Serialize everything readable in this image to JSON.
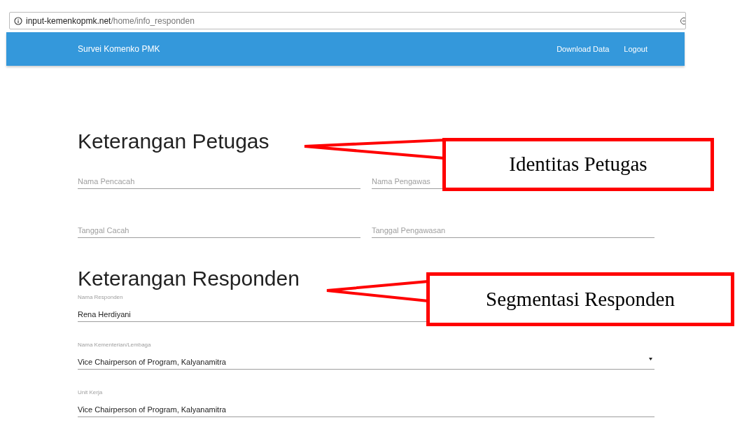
{
  "address_bar": {
    "host": "input-kemenkopmk.net",
    "path": "/home/info_responden"
  },
  "navbar": {
    "brand": "Survei Komenko PMK",
    "links": [
      "Download Data",
      "Logout"
    ]
  },
  "sections": [
    {
      "title": "Keterangan Petugas",
      "kind": "grid",
      "fields": [
        {
          "kind": "text",
          "placeholder": "Nama Pencacah"
        },
        {
          "kind": "text",
          "placeholder": "Nama Pengawas"
        },
        {
          "kind": "text",
          "placeholder": "Tanggal Cacah"
        },
        {
          "kind": "text",
          "placeholder": "Tanggal Pengawasan"
        }
      ]
    },
    {
      "title": "Keterangan Responden",
      "kind": "stack",
      "fields": [
        {
          "kind": "text",
          "label": "Nama Responden",
          "value": "Rena Herdiyani"
        },
        {
          "kind": "select",
          "label": "Nama Kementerian/Lembaga",
          "value": "Vice Chairperson of Program, Kalyanamitra"
        },
        {
          "kind": "text",
          "label": "Unit Kerja",
          "value": "Vice Chairperson of Program, Kalyanamitra"
        }
      ]
    }
  ],
  "callouts": [
    "Identitas Petugas",
    "Segmentasi Responden"
  ]
}
